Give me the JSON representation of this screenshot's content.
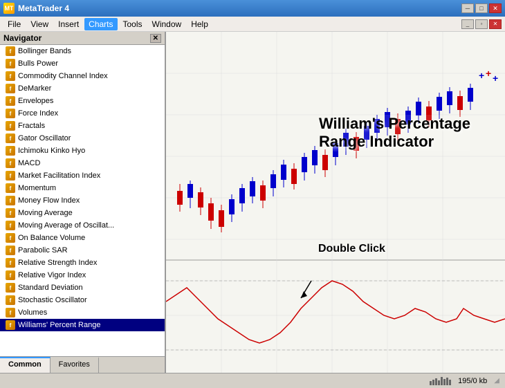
{
  "titlebar": {
    "title": "MetaTrader 4",
    "icon": "MT",
    "controls": {
      "minimize": "─",
      "maximize": "□",
      "close": "✕"
    },
    "inner_controls": {
      "minimize": "_",
      "maximize": "▫",
      "close": "✕"
    }
  },
  "menubar": {
    "items": [
      {
        "label": "File",
        "id": "file"
      },
      {
        "label": "View",
        "id": "view"
      },
      {
        "label": "Insert",
        "id": "insert"
      },
      {
        "label": "Charts",
        "id": "charts",
        "active": true
      },
      {
        "label": "Tools",
        "id": "tools"
      },
      {
        "label": "Window",
        "id": "window"
      },
      {
        "label": "Help",
        "id": "help"
      }
    ]
  },
  "navigator": {
    "title": "Navigator",
    "items": [
      {
        "label": "Bollinger Bands",
        "icon": "f"
      },
      {
        "label": "Bulls Power",
        "icon": "f"
      },
      {
        "label": "Commodity Channel Index",
        "icon": "f"
      },
      {
        "label": "DeMarker",
        "icon": "f"
      },
      {
        "label": "Envelopes",
        "icon": "f"
      },
      {
        "label": "Force Index",
        "icon": "f"
      },
      {
        "label": "Fractals",
        "icon": "f"
      },
      {
        "label": "Gator Oscillator",
        "icon": "f"
      },
      {
        "label": "Ichimoku Kinko Hyo",
        "icon": "f"
      },
      {
        "label": "MACD",
        "icon": "f"
      },
      {
        "label": "Market Facilitation Index",
        "icon": "f"
      },
      {
        "label": "Momentum",
        "icon": "f"
      },
      {
        "label": "Money Flow Index",
        "icon": "f"
      },
      {
        "label": "Moving Average",
        "icon": "f"
      },
      {
        "label": "Moving Average of Oscillat...",
        "icon": "f"
      },
      {
        "label": "On Balance Volume",
        "icon": "f"
      },
      {
        "label": "Parabolic SAR",
        "icon": "f"
      },
      {
        "label": "Relative Strength Index",
        "icon": "f"
      },
      {
        "label": "Relative Vigor Index",
        "icon": "f"
      },
      {
        "label": "Standard Deviation",
        "icon": "f"
      },
      {
        "label": "Stochastic Oscillator",
        "icon": "f"
      },
      {
        "label": "Volumes",
        "icon": "f"
      },
      {
        "label": "Williams' Percent Range",
        "icon": "f",
        "selected": true
      }
    ],
    "tabs": [
      {
        "label": "Common",
        "active": true
      },
      {
        "label": "Favorites"
      }
    ]
  },
  "chart": {
    "annotation": "William's Percentage\nRange Indicator",
    "double_click_label": "Double Click",
    "background": "#f5f5f0"
  },
  "statusbar": {
    "bars_label": "195/0 kb"
  }
}
